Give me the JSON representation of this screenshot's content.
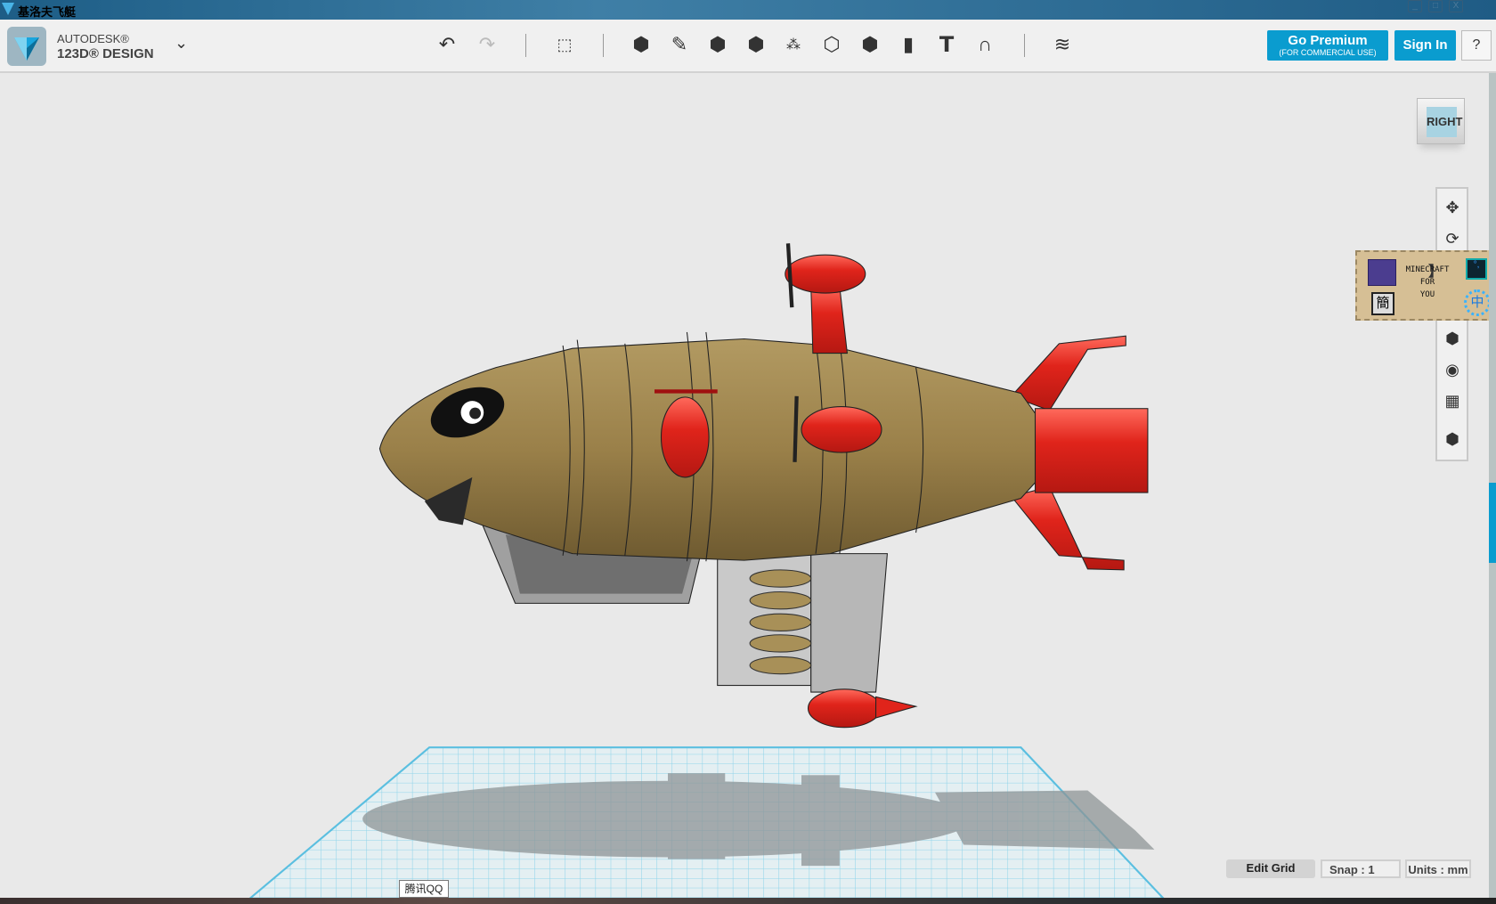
{
  "window": {
    "title": "基洛夫飞艇",
    "controls": [
      "_",
      "□",
      "X"
    ]
  },
  "brand": {
    "line1": "AUTODESK®",
    "line2": "123D® DESIGN"
  },
  "toolbar": {
    "menu_icon": "chevron-down-icon",
    "tools": [
      "undo",
      "redo",
      "transform",
      "primitives",
      "sketch",
      "construct",
      "modify",
      "pattern",
      "grouping",
      "combine",
      "measure",
      "text",
      "snap",
      "materials"
    ],
    "premium_label": "Go Premium",
    "premium_sub": "(FOR COMMERCIAL USE)",
    "signin_label": "Sign In",
    "help_label": "?"
  },
  "viewcube": {
    "face": "RIGHT"
  },
  "navbar": {
    "items": [
      "pan",
      "orbit",
      "zoom",
      "fit",
      "view-mode",
      "visibility",
      "grid-visibility",
      "material-snap"
    ]
  },
  "ime": {
    "text1": "MINECRAFT",
    "text2": "FOR",
    "text3": "YOU",
    "simplified": "簡",
    "chinese": "中",
    "bracket": "】",
    "punct": "°,"
  },
  "statusbar": {
    "edit_grid": "Edit Grid",
    "snap": "Snap  :  1",
    "units": "Units : mm"
  },
  "tooltip": "腾讯QQ",
  "colors": {
    "accent": "#0a9ccf",
    "hull": "#a08850",
    "red": "#e0241b",
    "grid": "#7fcde6"
  }
}
